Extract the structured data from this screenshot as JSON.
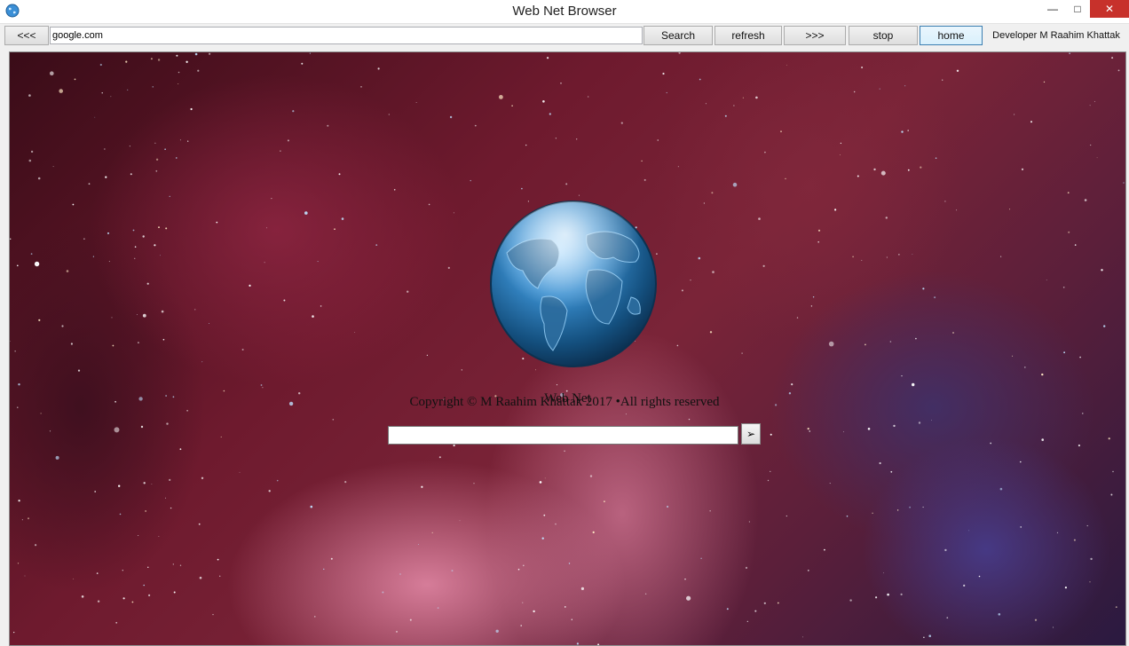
{
  "window": {
    "title": "Web Net Browser",
    "app_icon": "globe-icon",
    "controls": {
      "minimize_glyph": "—",
      "maximize_glyph": "□",
      "close_glyph": "✕"
    }
  },
  "toolbar": {
    "back_label": "<<<",
    "address_value": "google.com",
    "search_label": "Search",
    "refresh_label": "refresh",
    "forward_label": ">>>",
    "stop_label": "stop",
    "home_label": "home",
    "developer_label": "Developer M Raahim Khattak"
  },
  "page": {
    "logo": "earth-globe",
    "brand_name": "Web Net",
    "search": {
      "value": "",
      "go_glyph": "➢"
    },
    "copyright": "Copyright © M Raahim Khattak 2017 •All rights reserved"
  },
  "colors": {
    "close_button": "#c7312b",
    "nebula_dark": "#3a0c18",
    "nebula_mid": "#7a2438",
    "globe_blue": "#2a7ab8"
  }
}
